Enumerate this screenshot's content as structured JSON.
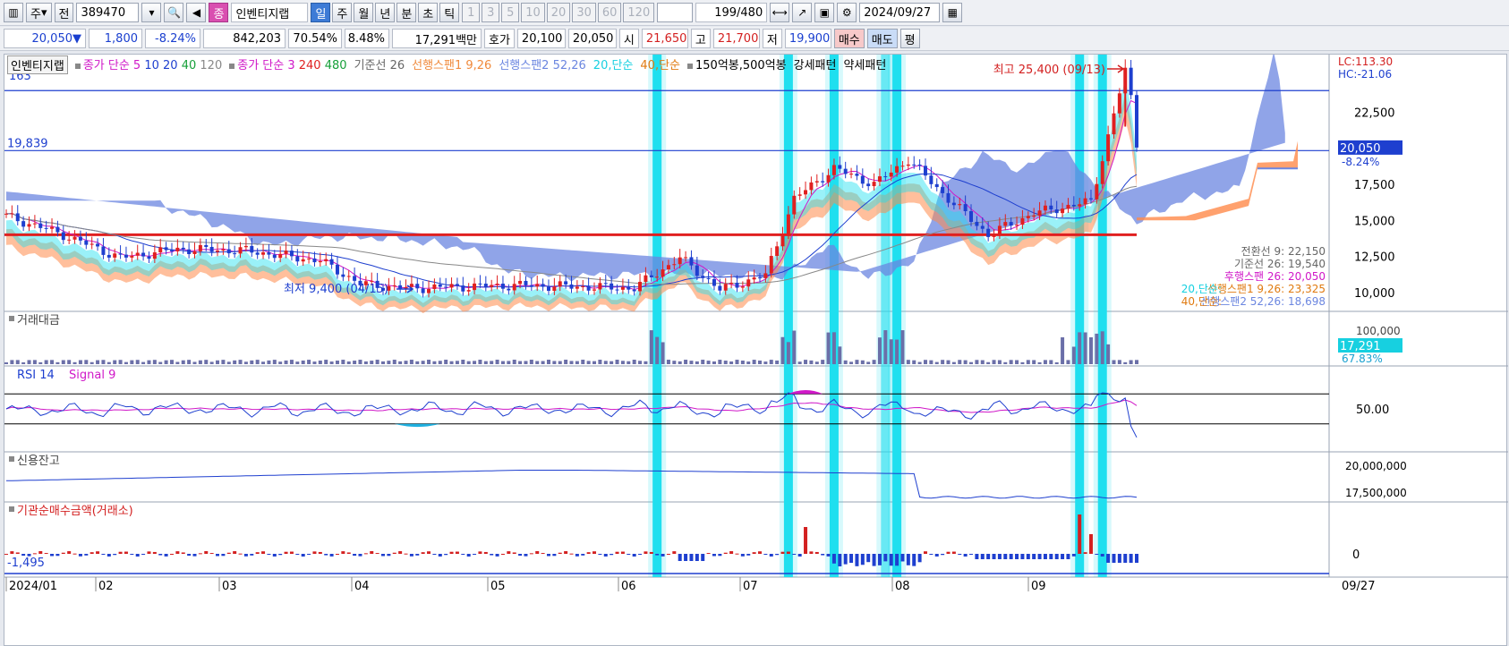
{
  "toolbar": {
    "market": "주",
    "prev": "전",
    "code": "389470",
    "stock_name": "인벤티지랩",
    "stock_badge": "종",
    "periods": [
      "일",
      "주",
      "월",
      "년",
      "분",
      "초",
      "틱"
    ],
    "active_period": "일",
    "minute_opts": [
      "1",
      "3",
      "5",
      "10",
      "20",
      "30",
      "60",
      "120"
    ],
    "count": "199",
    "total": "/480",
    "date": "2024/09/27"
  },
  "quote": {
    "price": "20,050",
    "arrow": "▼",
    "change": "1,800",
    "rate": "-8.24%",
    "volume": "842,203",
    "vol_ratio": "70.54%",
    "turnover": "8.48%",
    "amount": "17,291백만",
    "bid_label": "호가",
    "bid1": "20,100",
    "bid2": "20,050",
    "open_label": "시",
    "open": "21,650",
    "high_label": "고",
    "high": "21,700",
    "low_label": "저",
    "low": "19,900",
    "buy": "매수",
    "sell": "매도",
    "flat": "평"
  },
  "legend": {
    "name": "인벤티지랩",
    "ma_a": "종가 단순 5",
    "ma_a2": "10",
    "ma_a3": "20",
    "ma_a4": "40",
    "ma_a5": "120",
    "ma_b": "종가 단순 3",
    "ma_b2": "240",
    "ma_b3": "480",
    "base": "기준선 26",
    "span1": "선행스팬1 9,26",
    "span2": "선행스팬2 52,26",
    "s20": "20,단순",
    "s40": "40,단순",
    "pat": "150억봉,500억봉",
    "strong": "강세패턴",
    "weak": "약세패턴"
  },
  "right_top": {
    "lc": "LC:113.30",
    "hc": "HC:-21.06"
  },
  "price_axis": [
    "22,500",
    "20,050",
    "17,500",
    "15,000",
    "12,500",
    "10,000"
  ],
  "price_change": "-8.24%",
  "left_labels": {
    "top": "163",
    "line": "19,839"
  },
  "annotations": {
    "high": "최고 25,400 (09/13)",
    "low": "최저 9,400 (04/15)"
  },
  "ichimoku_readout": [
    "전환선 9: 22,150",
    "기준선 26: 19,540",
    "후행스팬 26: 20,050",
    "선행스팬1 9,26: 23,325",
    "선행스팬2 52,26: 18,698"
  ],
  "readout_ovr": [
    "20,단순:",
    "40,단순:"
  ],
  "panels": {
    "volume": {
      "title": "거래대금",
      "last": "17,291",
      "pct": "67.83%",
      "tick": "100,000"
    },
    "rsi": {
      "title": "RSI 14",
      "signal": "Signal 9",
      "tick": "50.00"
    },
    "credit": {
      "title": "신용잔고",
      "ticks": [
        "20,000,000",
        "17,500,000"
      ]
    },
    "inst": {
      "title": "기관순매수금액(거래소)",
      "zero": "0",
      "left": "-1,495"
    }
  },
  "x_axis": [
    "2024/01",
    "02",
    "03",
    "04",
    "05",
    "06",
    "07",
    "08",
    "09"
  ],
  "x_end": "09/27",
  "chart_data": {
    "type": "line",
    "title": "",
    "x": [
      "2024/01",
      "02",
      "03",
      "04",
      "05",
      "06",
      "07",
      "08",
      "09"
    ],
    "series": [
      {
        "name": "",
        "values": [
          15300,
          13000,
          12700,
          11200,
          10500,
          10300,
          13000,
          15000,
          20050
        ]
      }
    ],
    "ylim": [
      9000,
      26000
    ],
    "annotations": [
      {
        "label": "최고 25,400 (09/13)"
      },
      {
        "label": "최저 9,400 (04/15)"
      }
    ]
  },
  "colors": {
    "up": "#e02020",
    "down": "#1e3fcf",
    "cloud_up": "#ff8a4a",
    "cloud_dn": "#6b86e0",
    "cyan": "#1fe0f0",
    "magenta": "#d018c8"
  }
}
